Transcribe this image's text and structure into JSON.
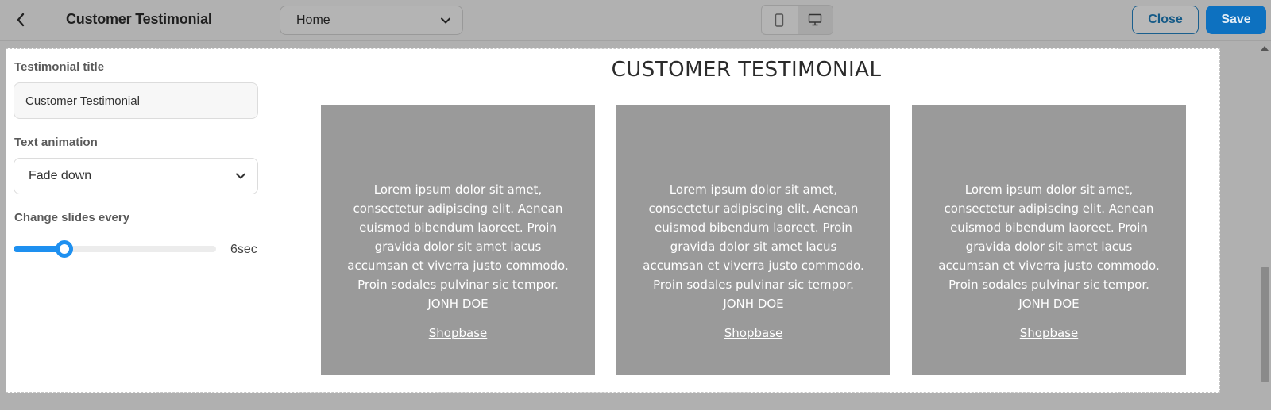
{
  "header": {
    "back_icon": "chevron-left-icon",
    "title": "Customer Testimonial",
    "page_select": {
      "value": "Home",
      "icon": "chevron-down-icon"
    },
    "device_toggle": {
      "mobile_icon": "mobile-icon",
      "desktop_icon": "desktop-icon",
      "active": "desktop"
    },
    "close_label": "Close",
    "save_label": "Save",
    "save_color": "#0d71c0"
  },
  "settings": {
    "title_label": "Testimonial title",
    "title_value": "Customer Testimonial",
    "animation_label": "Text animation",
    "animation_value": "Fade down",
    "slides_label": "Change slides every",
    "slides_value_text": "6sec",
    "slider_fraction": 0.25,
    "accent_color": "#1e90f0"
  },
  "preview": {
    "section_title": "CUSTOMER TESTIMONIAL",
    "cards": [
      {
        "quote": "Lorem ipsum dolor sit amet, consectetur adipiscing elit. Aenean euismod bibendum laoreet. Proin gravida dolor sit amet lacus accumsan et viverra justo commodo. Proin sodales pulvinar sic tempor.",
        "author": "JONH DOE",
        "link": "Shopbase"
      },
      {
        "quote": "Lorem ipsum dolor sit amet, consectetur adipiscing elit. Aenean euismod bibendum laoreet. Proin gravida dolor sit amet lacus accumsan et viverra justo commodo. Proin sodales pulvinar sic tempor.",
        "author": "JONH DOE",
        "link": "Shopbase"
      },
      {
        "quote": "Lorem ipsum dolor sit amet, consectetur adipiscing elit. Aenean euismod bibendum laoreet. Proin gravida dolor sit amet lacus accumsan et viverra justo commodo. Proin sodales pulvinar sic tempor.",
        "author": "JONH DOE",
        "link": "Shopbase"
      }
    ]
  }
}
